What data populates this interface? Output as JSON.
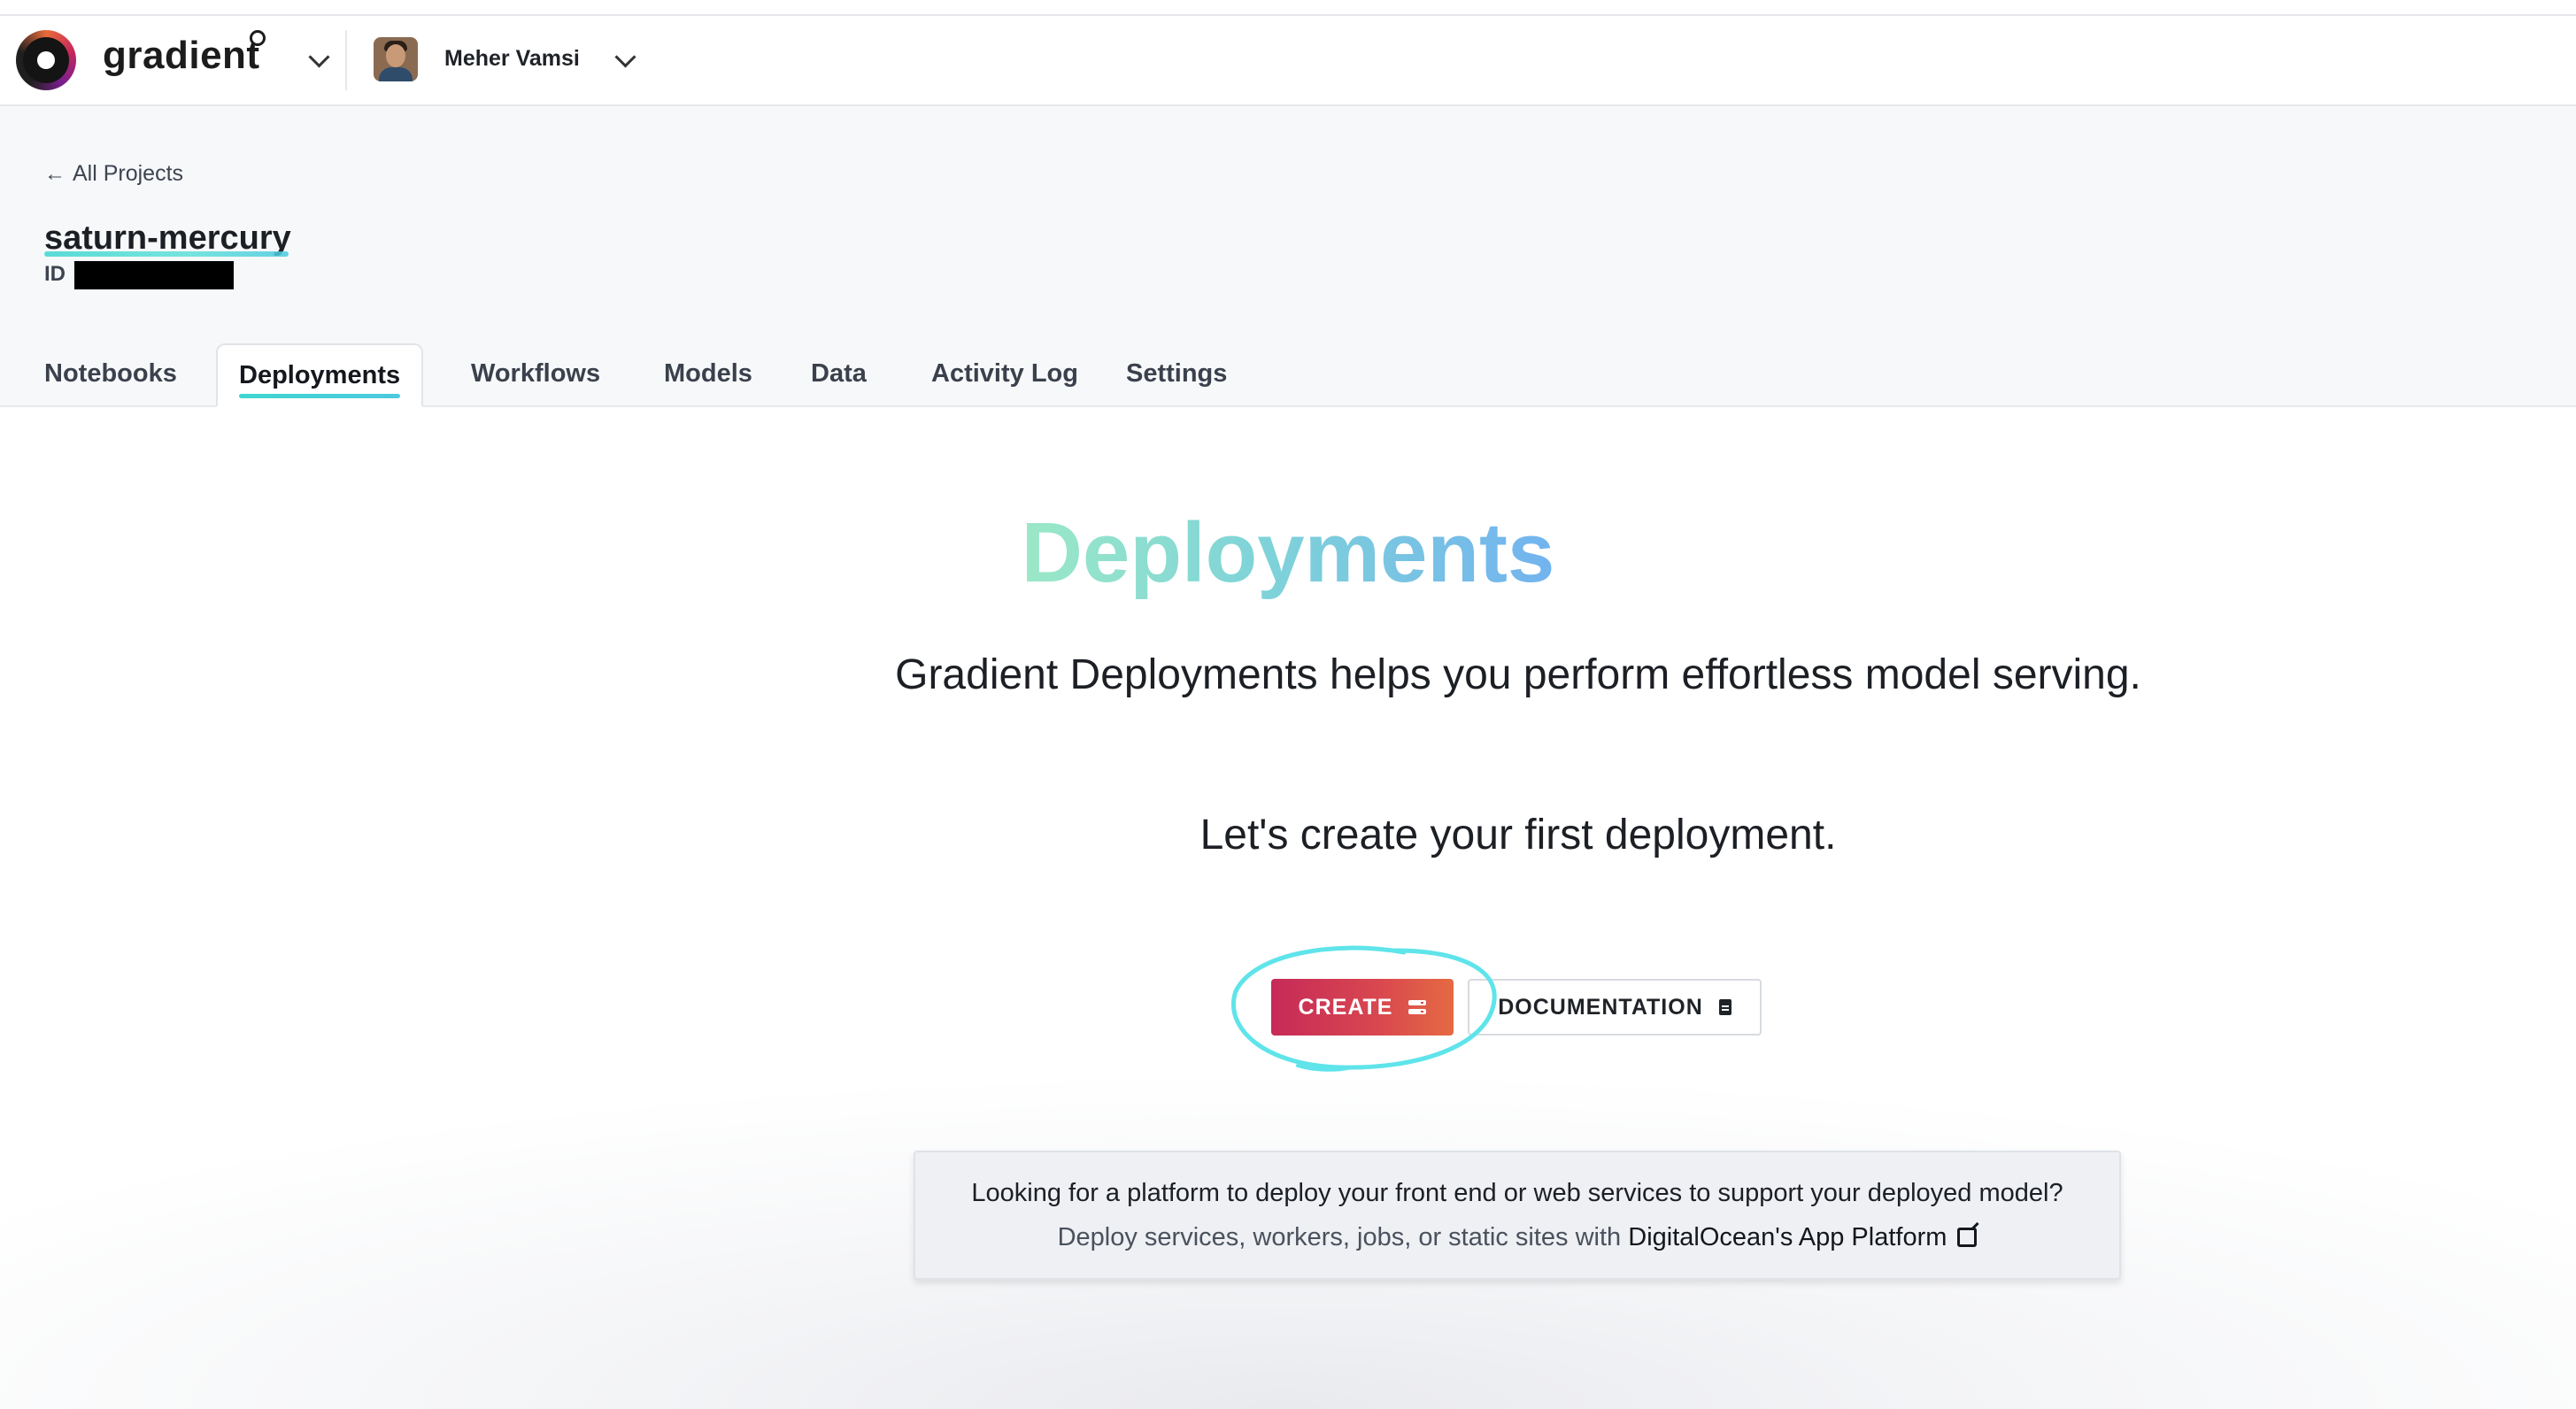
{
  "header": {
    "brand": "gradient",
    "user_name": "Meher Vamsi"
  },
  "project": {
    "back_link": "All Projects",
    "name": "saturn-mercury",
    "id_label": "ID"
  },
  "tabs": [
    {
      "label": "Notebooks",
      "active": false
    },
    {
      "label": "Deployments",
      "active": true
    },
    {
      "label": "Workflows",
      "active": false
    },
    {
      "label": "Models",
      "active": false
    },
    {
      "label": "Data",
      "active": false
    },
    {
      "label": "Activity Log",
      "active": false
    },
    {
      "label": "Settings",
      "active": false
    }
  ],
  "main": {
    "title": "Deployments",
    "description": "Gradient Deployments helps you perform effortless model serving.",
    "cta_text": "Let's create your first deployment.",
    "create_label": "CREATE",
    "documentation_label": "DOCUMENTATION"
  },
  "info": {
    "question": "Looking for a platform to deploy your front end or web services to support your deployed model?",
    "answer_prefix": "Deploy services, workers, jobs, or static sites with",
    "link_text": "DigitalOcean's App Platform"
  },
  "colors": {
    "accent_cyan": "#3ed6d0",
    "create_gradient_start": "#c62a58",
    "create_gradient_end": "#e56a42",
    "title_gradient_start": "#9be8c7",
    "title_gradient_end": "#72b3ef"
  },
  "icons": {
    "logo": "gradient-logo-icon",
    "team_dropdown": "chevron-down-icon",
    "user_dropdown": "chevron-down-icon",
    "back": "arrow-left-icon",
    "create": "server-icon",
    "documentation": "document-icon",
    "external": "external-link-icon"
  }
}
